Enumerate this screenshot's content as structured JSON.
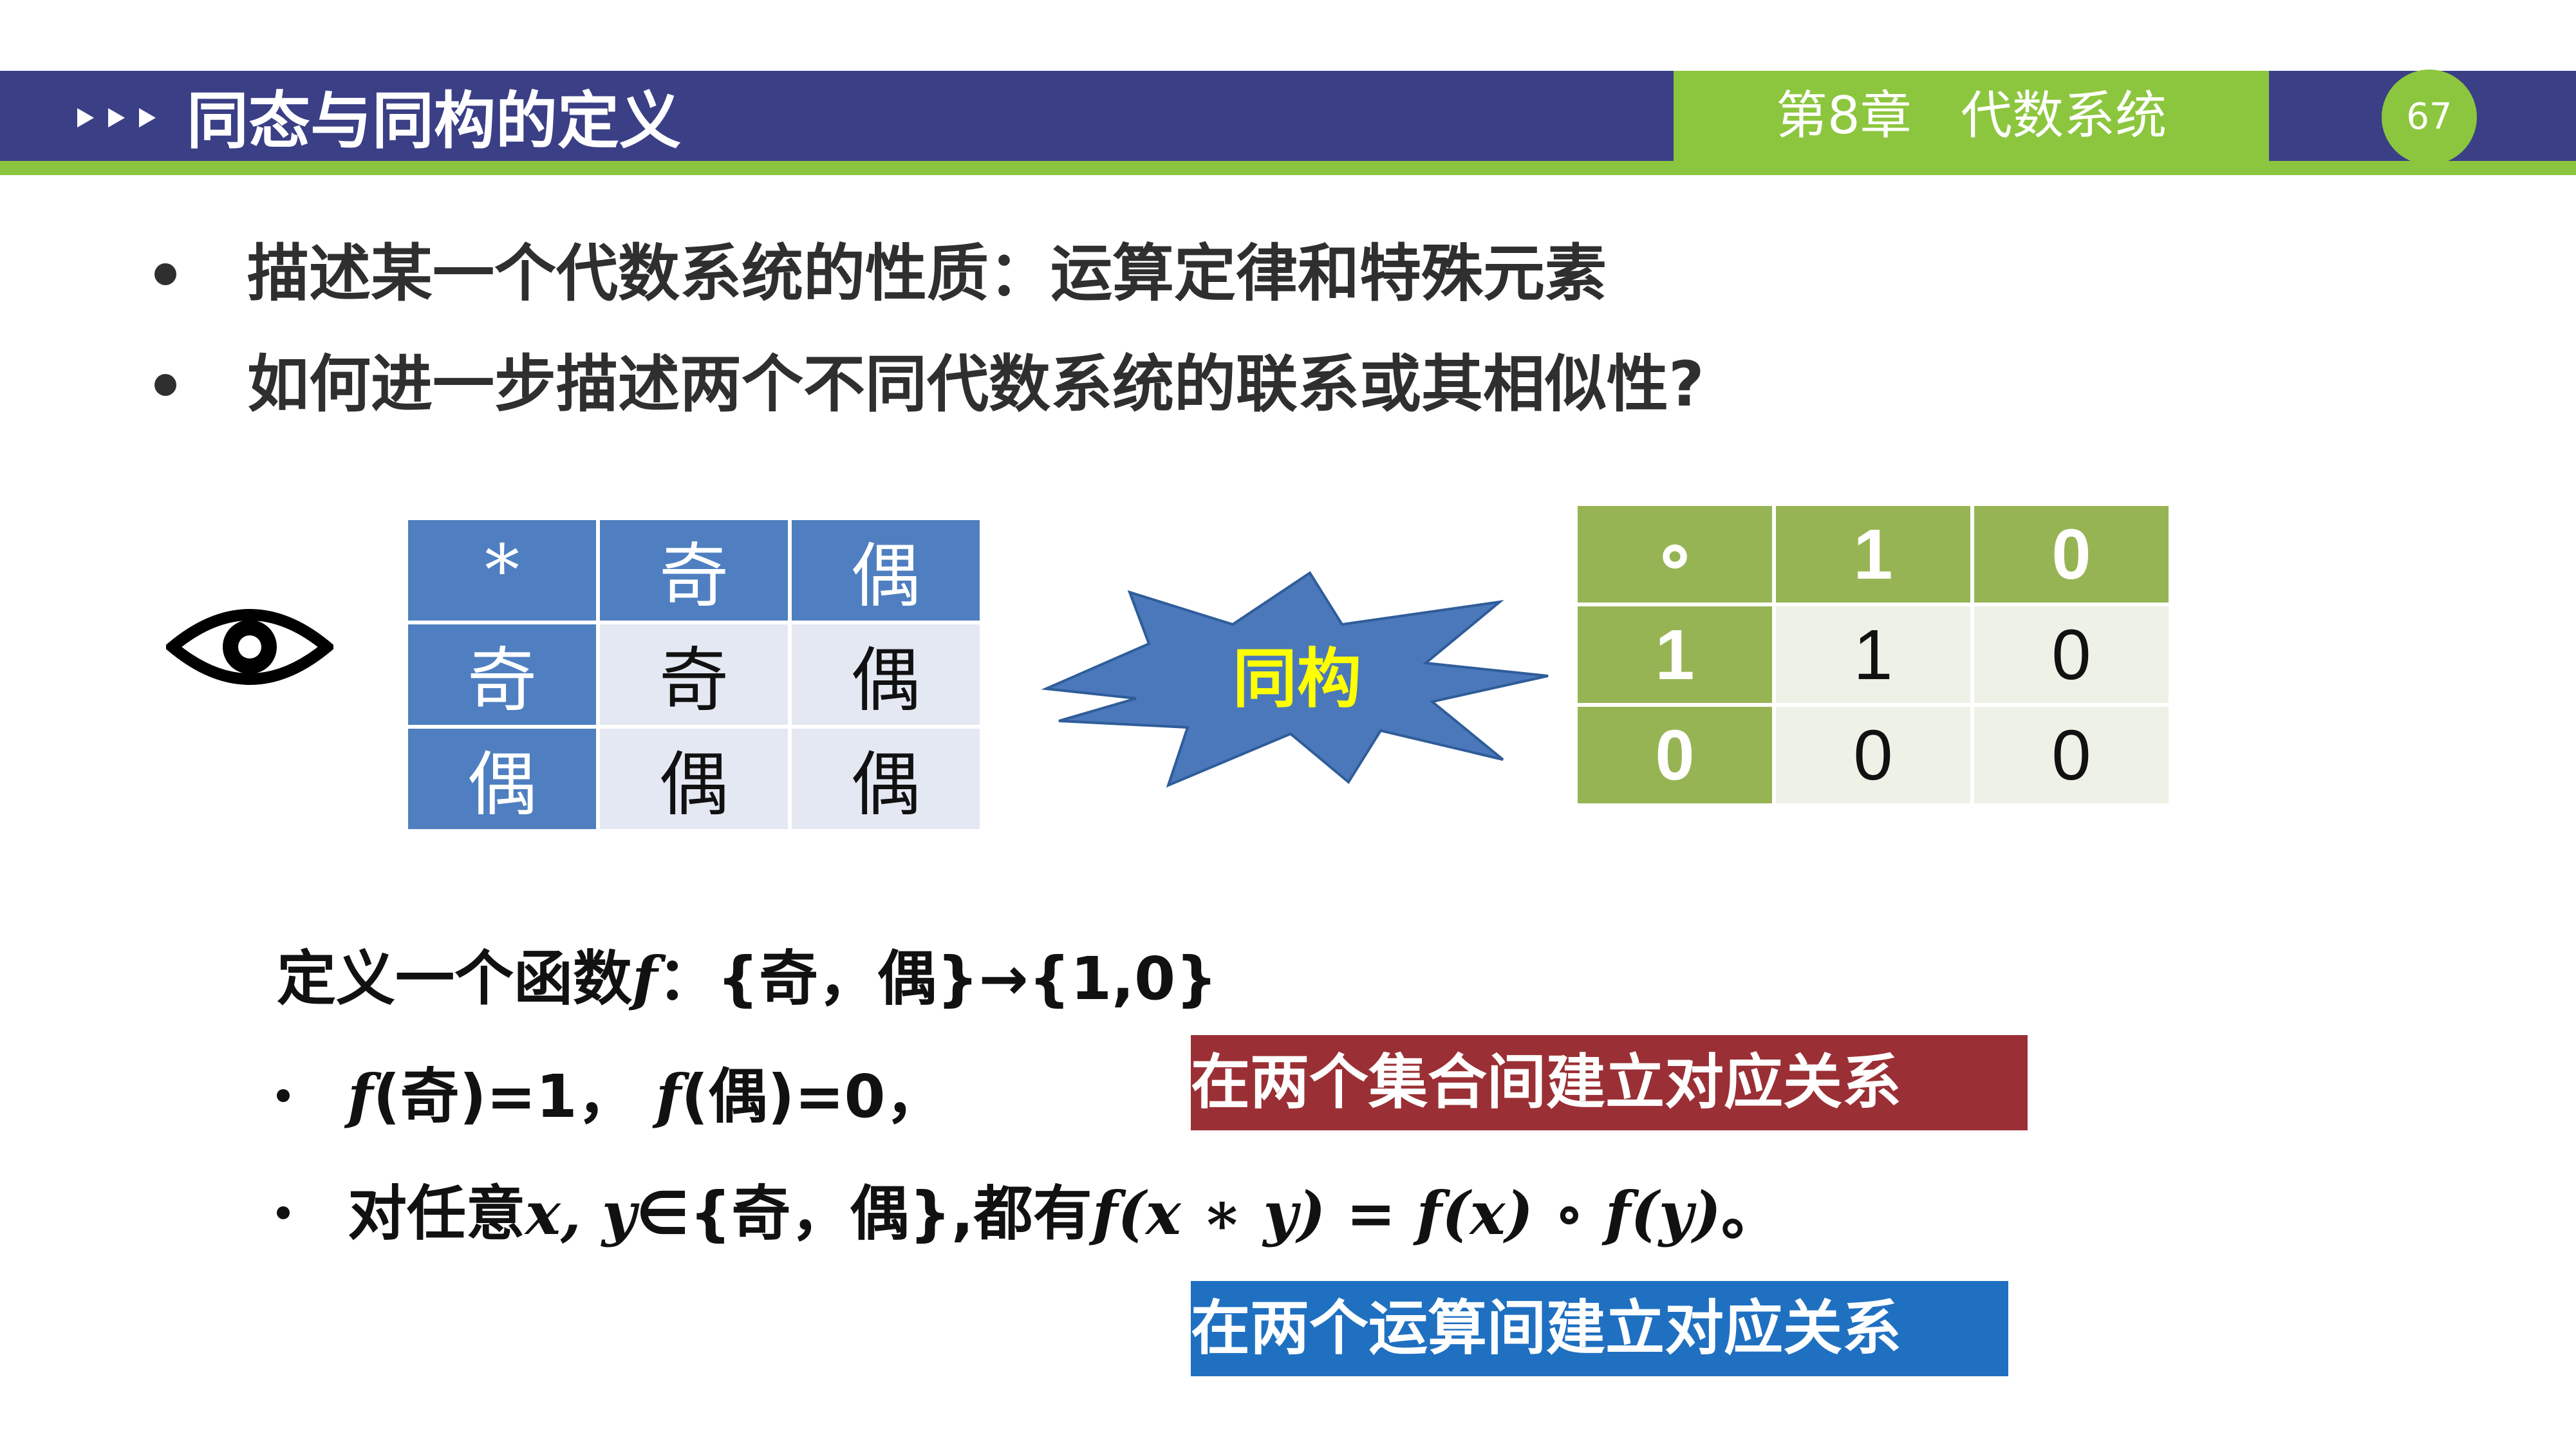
{
  "header": {
    "title": "同态与同构的定义",
    "chapter": "第8章   代数系统",
    "page_number": "67"
  },
  "bullets": [
    "描述某一个代数系统的性质：运算定律和特殊元素",
    "如何进一步描述两个不同代数系统的联系或其相似性?"
  ],
  "parity_table": {
    "header": [
      "*",
      "奇",
      "偶"
    ],
    "rows": [
      [
        "奇",
        "奇",
        "偶"
      ],
      [
        "偶",
        "偶",
        "偶"
      ]
    ]
  },
  "binary_table": {
    "header": [
      "∘",
      "1",
      "0"
    ],
    "rows": [
      [
        "1",
        "1",
        "0"
      ],
      [
        "0",
        "0",
        "0"
      ]
    ]
  },
  "burst_label": "同构",
  "definition": {
    "line1_text": "定义一个函数",
    "line1_f": "f",
    "line1_rest": "：{奇，偶}→{1,0}",
    "item1_f1": "f",
    "item1_part1": "(奇)=1，",
    "item1_f2": "f",
    "item1_part2": "(偶)=0，",
    "item2_text": "对任意",
    "item2_vars": "x, y",
    "item2_set": "∈{奇，偶},都有",
    "item2_formula": "f(x ∗ y) = f(x) ∘ f(y)",
    "item2_end": "。"
  },
  "callouts": {
    "sets": "在两个集合间建立对应关系",
    "operations": "在两个运算间建立对应关系"
  },
  "colors": {
    "header_navy": "#3a3f86",
    "accent_green": "#8cc63e",
    "table_blue": "#4f7fc0",
    "table_olive": "#97b454",
    "callout_red": "#9a3035",
    "callout_blue": "#1f70c1",
    "burst_fill": "#4a78ba",
    "burst_text": "#ffff00"
  },
  "icons": [
    "eye-icon",
    "play-arrows-icon",
    "starburst-shape"
  ]
}
